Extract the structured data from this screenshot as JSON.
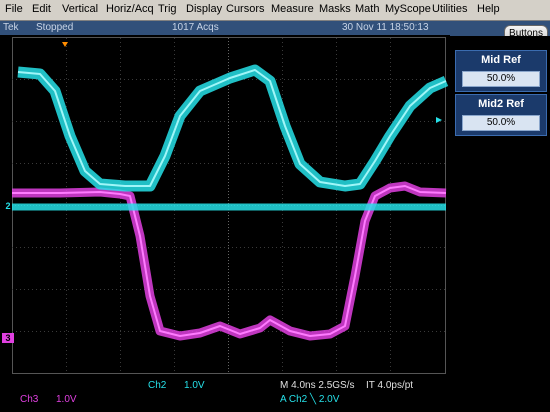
{
  "menu": [
    "File",
    "Edit",
    "Vertical",
    "Horiz/Acq",
    "Trig",
    "Display",
    "Cursors",
    "Measure",
    "Masks",
    "Math",
    "MyScope",
    "Utilities",
    "Help"
  ],
  "status": {
    "brand": "Tek",
    "state": "Stopped",
    "acqs": "1017 Acqs",
    "datetime": "30 Nov 11 18:50:13"
  },
  "buttons_label": "Buttons",
  "refs": [
    {
      "label": "Mid Ref",
      "value": "50.0%"
    },
    {
      "label": "Mid2 Ref",
      "value": "50.0%"
    }
  ],
  "markers": {
    "ch2": "2",
    "ch3": "3"
  },
  "readouts": {
    "ch2_name": "Ch2",
    "ch2_scale": "1.0V",
    "ch3_name": "Ch3",
    "ch3_scale": "1.0V",
    "timebase": "M 4.0ns 2.5GS/s",
    "interp": "IT 4.0ps/pt",
    "trigger": "A  Ch2  ╲  2.0V"
  },
  "colors": {
    "ch2": "#26e0e8",
    "ch3": "#e040e0",
    "status_bg": "#31507a",
    "menu_bg": "#d4d0c8"
  }
}
